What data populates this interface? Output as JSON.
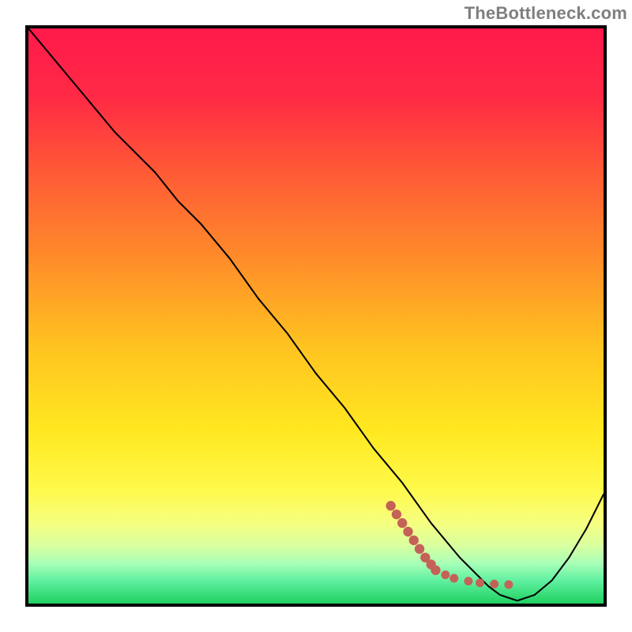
{
  "chart_data": {
    "type": "line",
    "attribution": "TheBottleneck.com",
    "title": "",
    "xlabel": "",
    "ylabel": "",
    "xlim": [
      0,
      100
    ],
    "ylim": [
      0,
      100
    ],
    "grid": false,
    "series": [
      {
        "name": "main-curve",
        "stroke": "#000000",
        "style": "solid",
        "x": [
          0,
          5,
          10,
          15,
          18,
          22,
          26,
          30,
          35,
          40,
          45,
          50,
          55,
          60,
          65,
          70,
          75,
          78,
          80,
          82,
          85,
          88,
          91,
          94,
          97,
          100
        ],
        "y": [
          100,
          94,
          88,
          82,
          79,
          75,
          70,
          66,
          60,
          53,
          47,
          40,
          34,
          27,
          21,
          14,
          8,
          5,
          3,
          1.5,
          0.5,
          1.5,
          4,
          8,
          13,
          19
        ]
      },
      {
        "name": "dotted-marker",
        "stroke": "#c56258",
        "style": "dotted-thick",
        "x": [
          63,
          64,
          65,
          66,
          67,
          68,
          69,
          70,
          70.8,
          72.5,
          74,
          76.5,
          78.5,
          81,
          83.5
        ],
        "y": [
          17,
          15.5,
          14,
          12.5,
          11,
          9.5,
          8,
          6.8,
          5.8,
          5.0,
          4.4,
          3.9,
          3.6,
          3.4,
          3.3
        ]
      }
    ]
  }
}
